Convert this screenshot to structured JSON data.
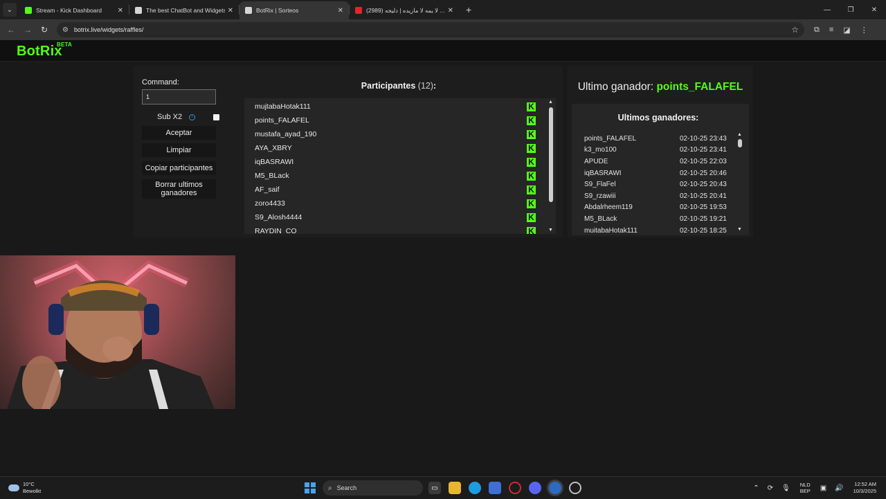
{
  "browser": {
    "tabs": [
      {
        "title": "Stream - Kick Dashboard",
        "favicon_color": "#53fc18",
        "active": false
      },
      {
        "title": "The best ChatBot and Widgets",
        "favicon_color": "#d6d6d6",
        "active": false
      },
      {
        "title": "BotRix | Sorteos",
        "favicon_color": "#d6d6d6",
        "active": true
      },
      {
        "title": "لا يمه لا ماريده | دليجه (2989) ...",
        "favicon_color": "#e0262b",
        "active": false
      }
    ],
    "url": "botrix.live/widgets/raffles/"
  },
  "site": {
    "logo": "BotRix",
    "logo_badge": "BETA",
    "accent_color": "#53fc18"
  },
  "controls": {
    "command_label": "Command:",
    "command_value": "1",
    "sub_label": "Sub X2",
    "sub_checked": false,
    "accept_label": "Aceptar",
    "clear_label": "Limpiar",
    "copy_label": "Copiar participantes",
    "clear_winners_label": "Borrar ultimos ganadores"
  },
  "participants": {
    "title": "Participantes",
    "count": "(12)",
    "colon": ":",
    "items": [
      "mujtabaHotak111",
      "points_FALAFEL",
      "mustafa_ayad_190",
      "AYA_XBRY",
      "iqBASRAWI",
      "M5_BLack",
      "AF_saif",
      "zoro4433",
      "S9_Alosh4444",
      "RAYDIN_CO"
    ]
  },
  "winners": {
    "last_winner_label": "Ultimo ganador:",
    "last_winner_name": "points_FALAFEL",
    "list_title": "Ultimos ganadores:",
    "rows": [
      {
        "name": "points_FALAFEL",
        "date": "02-10-25 23:43"
      },
      {
        "name": "k3_mo100",
        "date": "02-10-25 23:41"
      },
      {
        "name": "APUDE",
        "date": "02-10-25 22:03"
      },
      {
        "name": "iqBASRAWI",
        "date": "02-10-25 20:46"
      },
      {
        "name": "S9_FlaFel",
        "date": "02-10-25 20:43"
      },
      {
        "name": "S9_rzawiii",
        "date": "02-10-25 20:41"
      },
      {
        "name": "Abdalrheem119",
        "date": "02-10-25 19:53"
      },
      {
        "name": "M5_BLack",
        "date": "02-10-25 19:21"
      },
      {
        "name": "mujtabaHotak111",
        "date": "02-10-25 18:25"
      }
    ]
  },
  "taskbar": {
    "weather_temp": "10°C",
    "weather_desc": "Bewolkt",
    "search_label": "Search",
    "lang_line1": "NLD",
    "lang_line2": "BEP",
    "time": "12:52 AM",
    "date": "10/3/2025"
  }
}
